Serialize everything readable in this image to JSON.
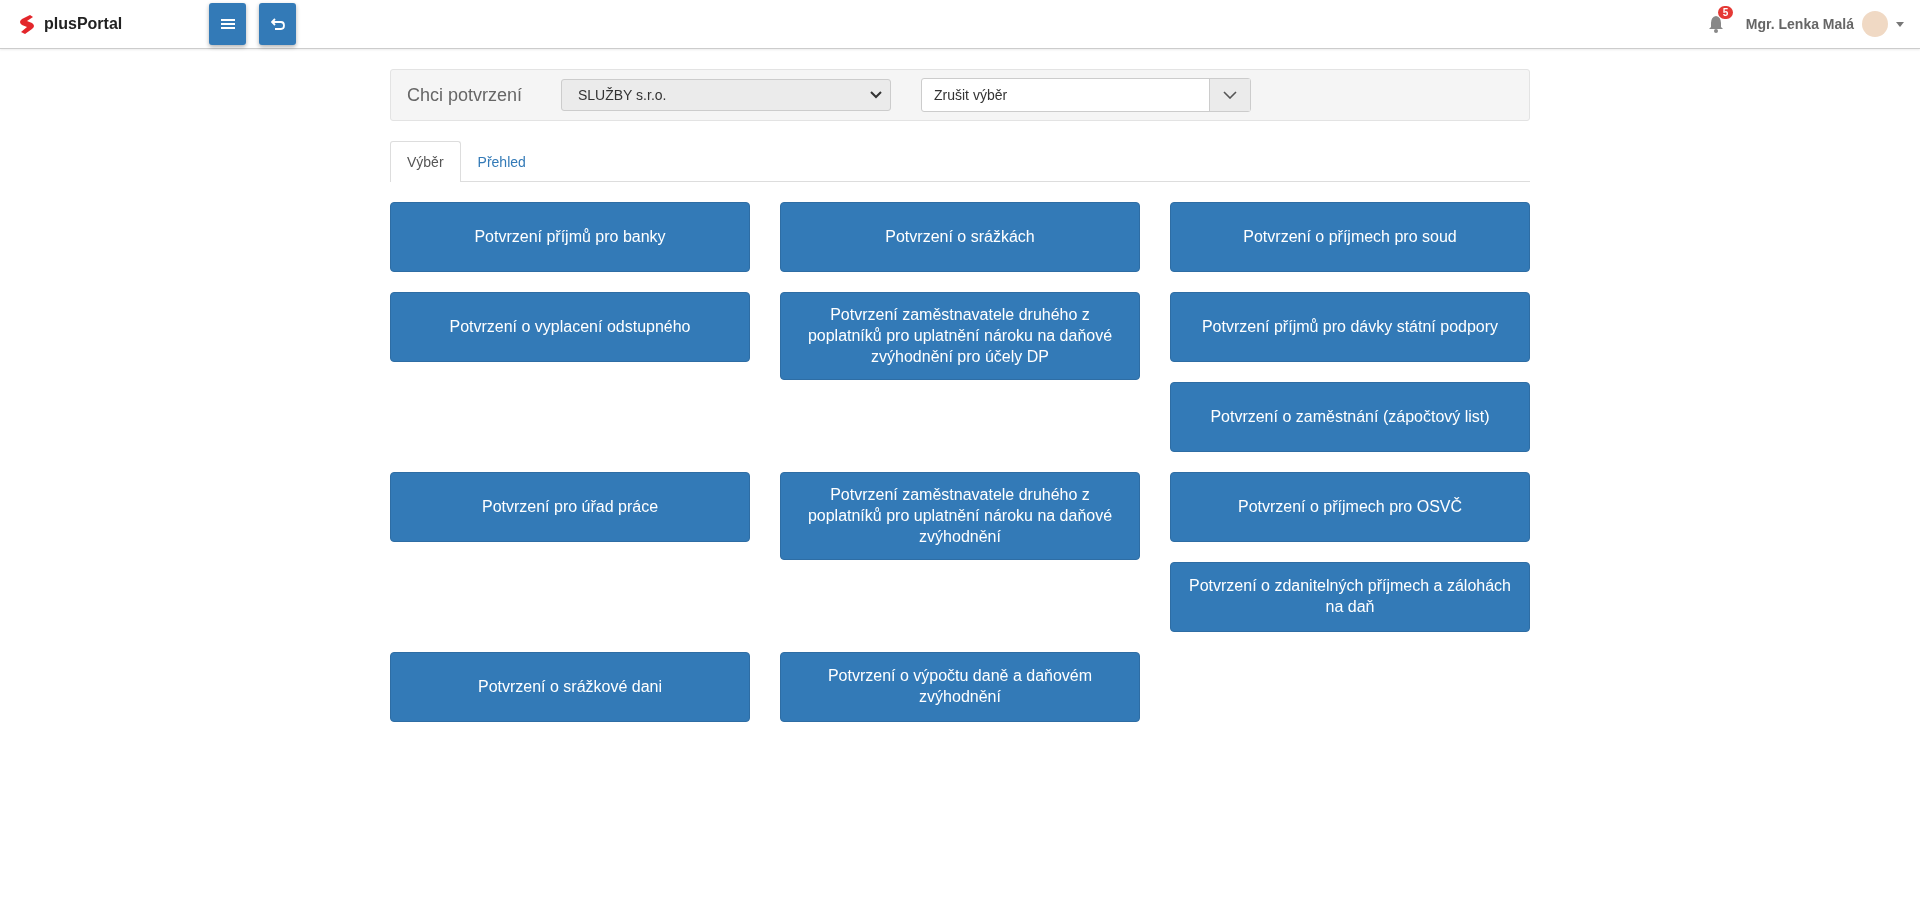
{
  "header": {
    "logo": "plusPortal",
    "notifications": "5",
    "user": "Mgr. Lenka Malá"
  },
  "filter": {
    "label": "Chci potvrzení",
    "company": "SLUŽBY s.r.o.",
    "selection": "Zrušit výběr"
  },
  "tabs": [
    {
      "label": "Výběr",
      "selected": true
    },
    {
      "label": "Přehled",
      "selected": false
    }
  ],
  "rows": [
    {
      "cells": [
        [
          "Potvrzení příjmů pro banky"
        ],
        [
          "Potvrzení o srážkách"
        ],
        [
          "Potvrzení o příjmech pro soud"
        ]
      ]
    },
    {
      "cells": [
        [
          "Potvrzení o vyplacení odstupného"
        ],
        [
          "Potvrzení zaměstnavatele druhého z poplatníků pro uplatnění nároku na daňové zvýhodnění pro účely DP"
        ],
        [
          "Potvrzení příjmů pro dávky státní podpory",
          "Potvrzení o zaměstnání (zápočtový list)"
        ]
      ]
    },
    {
      "cells": [
        [
          "Potvrzení pro úřad práce"
        ],
        [
          "Potvrzení zaměstnavatele druhého z poplatníků pro uplatnění nároku na daňové zvýhodnění"
        ],
        [
          "Potvrzení o příjmech pro OSVČ",
          "Potvrzení o zdanitelných příjmech a zálohách na daň"
        ]
      ]
    },
    {
      "cells": [
        [
          "Potvrzení o srážkové dani"
        ],
        [
          "Potvrzení o výpočtu daně a daňovém zvýhodnění"
        ]
      ]
    }
  ]
}
